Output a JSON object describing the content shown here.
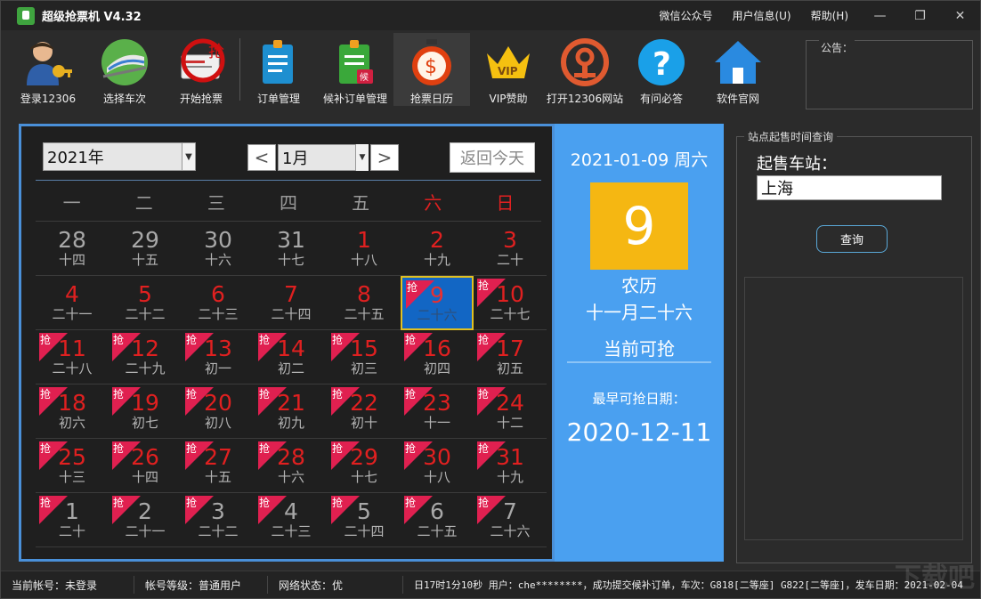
{
  "window": {
    "title": "超级抢票机 V4.32",
    "menu": [
      "微信公众号",
      "用户信息(U)",
      "帮助(H)"
    ]
  },
  "toolbar": {
    "items": [
      {
        "label": "登录12306",
        "icon": "login-user-key-icon"
      },
      {
        "label": "选择车次",
        "icon": "train-icon"
      },
      {
        "label": "开始抢票",
        "icon": "ticket-grab-icon"
      },
      {
        "label": "订单管理",
        "icon": "order-document-icon"
      },
      {
        "label": "候补订单管理",
        "icon": "waitlist-document-icon"
      },
      {
        "label": "抢票日历",
        "icon": "stopwatch-calendar-icon"
      },
      {
        "label": "VIP赞助",
        "icon": "vip-crown-icon"
      },
      {
        "label": "打开12306网站",
        "icon": "railway-logo-icon"
      },
      {
        "label": "有问必答",
        "icon": "question-icon"
      },
      {
        "label": "软件官网",
        "icon": "home-icon"
      }
    ]
  },
  "notice": {
    "label": "公告："
  },
  "calendar": {
    "year": "2021年",
    "month": "1月",
    "prev": "<",
    "next": ">",
    "today_btn": "返回今天",
    "weekdays": [
      "一",
      "二",
      "三",
      "四",
      "五",
      "六",
      "日"
    ],
    "badge_text": "抢",
    "days": [
      {
        "d": "28",
        "l": "十四",
        "grey": true
      },
      {
        "d": "29",
        "l": "十五",
        "grey": true
      },
      {
        "d": "30",
        "l": "十六",
        "grey": true
      },
      {
        "d": "31",
        "l": "十七",
        "grey": true
      },
      {
        "d": "1",
        "l": "十八"
      },
      {
        "d": "2",
        "l": "十九"
      },
      {
        "d": "3",
        "l": "二十"
      },
      {
        "d": "4",
        "l": "二十一"
      },
      {
        "d": "5",
        "l": "二十二"
      },
      {
        "d": "6",
        "l": "二十三"
      },
      {
        "d": "7",
        "l": "二十四"
      },
      {
        "d": "8",
        "l": "二十五"
      },
      {
        "d": "9",
        "l": "二十六",
        "badge": true,
        "selected": true
      },
      {
        "d": "10",
        "l": "二十七",
        "badge": true
      },
      {
        "d": "11",
        "l": "二十八",
        "badge": true
      },
      {
        "d": "12",
        "l": "二十九",
        "badge": true
      },
      {
        "d": "13",
        "l": "初一",
        "badge": true
      },
      {
        "d": "14",
        "l": "初二",
        "badge": true
      },
      {
        "d": "15",
        "l": "初三",
        "badge": true
      },
      {
        "d": "16",
        "l": "初四",
        "badge": true
      },
      {
        "d": "17",
        "l": "初五",
        "badge": true
      },
      {
        "d": "18",
        "l": "初六",
        "badge": true
      },
      {
        "d": "19",
        "l": "初七",
        "badge": true
      },
      {
        "d": "20",
        "l": "初八",
        "badge": true
      },
      {
        "d": "21",
        "l": "初九",
        "badge": true
      },
      {
        "d": "22",
        "l": "初十",
        "badge": true
      },
      {
        "d": "23",
        "l": "十一",
        "badge": true
      },
      {
        "d": "24",
        "l": "十二",
        "badge": true
      },
      {
        "d": "25",
        "l": "十三",
        "badge": true
      },
      {
        "d": "26",
        "l": "十四",
        "badge": true
      },
      {
        "d": "27",
        "l": "十五",
        "badge": true
      },
      {
        "d": "28",
        "l": "十六",
        "badge": true
      },
      {
        "d": "29",
        "l": "十七",
        "badge": true
      },
      {
        "d": "30",
        "l": "十八",
        "badge": true
      },
      {
        "d": "31",
        "l": "十九",
        "badge": true
      },
      {
        "d": "1",
        "l": "二十",
        "badge": true,
        "grey": true
      },
      {
        "d": "2",
        "l": "二十一",
        "badge": true,
        "grey": true
      },
      {
        "d": "3",
        "l": "二十二",
        "badge": true,
        "grey": true
      },
      {
        "d": "4",
        "l": "二十三",
        "badge": true,
        "grey": true
      },
      {
        "d": "5",
        "l": "二十四",
        "badge": true,
        "grey": true
      },
      {
        "d": "6",
        "l": "二十五",
        "badge": true,
        "grey": true
      },
      {
        "d": "7",
        "l": "二十六",
        "badge": true,
        "grey": true
      }
    ]
  },
  "info": {
    "date": "2021-01-09  周六",
    "day": "9",
    "lunar_label": "农历",
    "lunar": "十一月二十六",
    "status": "当前可抢",
    "earliest_label": "最早可抢日期：",
    "earliest": "2020-12-11"
  },
  "query": {
    "legend": "站点起售时间查询",
    "label": "起售车站：",
    "station": "上海",
    "button": "查询"
  },
  "status": {
    "account": "当前帐号：未登录",
    "level": "帐号等级：普通用户",
    "network": "网络状态：优",
    "log": "日17时1分10秒 用户：che********，成功提交候补订单，车次：G818[二等座] G822[二等座]，发车日期：2021-02-04"
  },
  "colors": {
    "accent": "#4aa0f0",
    "badge": "#e02050",
    "weekend": "#e02020",
    "today_box": "#f5b712"
  }
}
